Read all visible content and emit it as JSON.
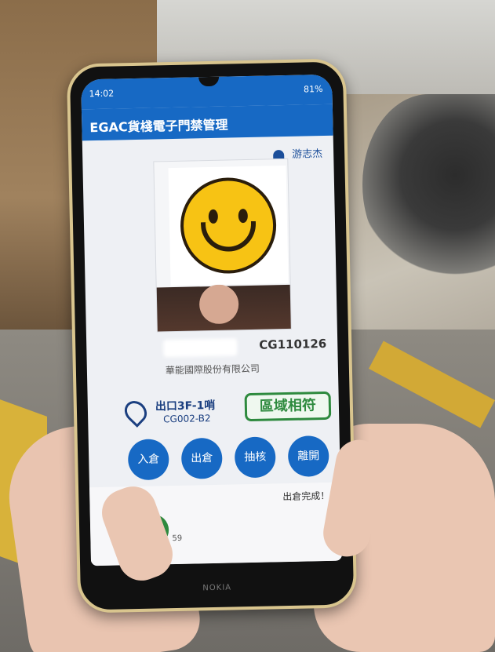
{
  "status_bar": {
    "time": "14:02",
    "battery": "81%"
  },
  "app": {
    "title": "EGAC貨棧電子門禁管理"
  },
  "user": {
    "name": "游志杰"
  },
  "card": {
    "badge_id": "CG110126",
    "company": "華能國際股份有限公司"
  },
  "location": {
    "name": "出口3F-1哨",
    "code": "CG002-B2",
    "match_label": "區域相符"
  },
  "actions": [
    "入倉",
    "出倉",
    "抽核",
    "離開"
  ],
  "message": {
    "text": "出倉完成！",
    "countdown": "59"
  },
  "device": {
    "brand": "NOKIA"
  },
  "colors": {
    "primary": "#1769c4",
    "match": "#2e8a3e",
    "frame": "#d9c58e"
  },
  "icons": {
    "user": "user-icon",
    "location": "location-pin-icon",
    "back": "arrow-left-icon"
  }
}
